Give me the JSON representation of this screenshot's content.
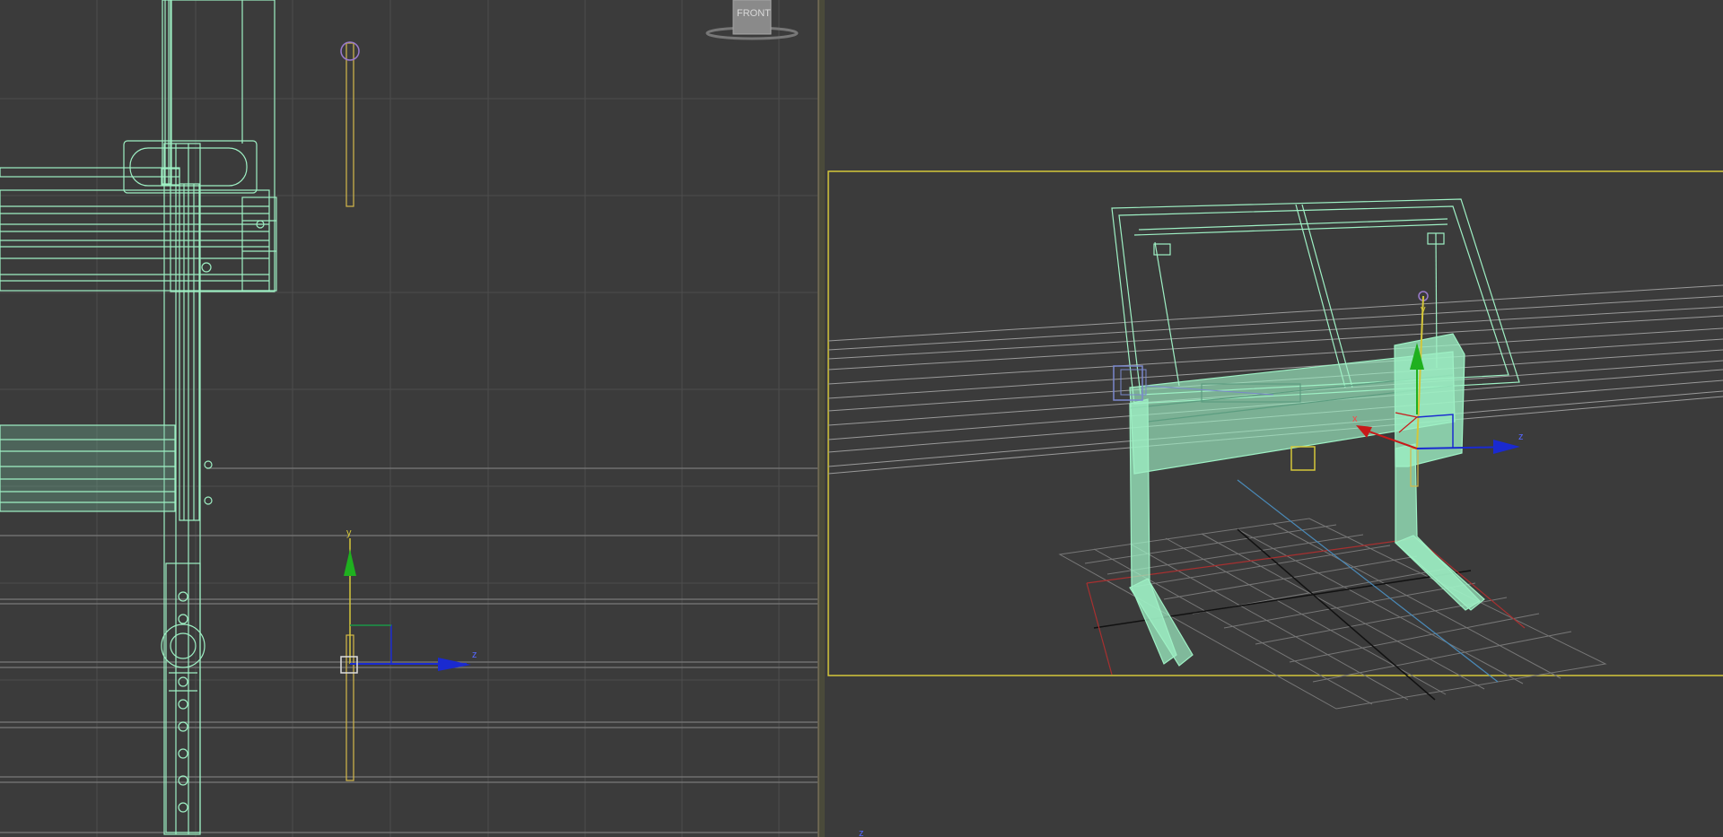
{
  "left_viewport": {
    "viewcube": {
      "face_label": "FRONT"
    },
    "gizmo": {
      "y_label": "y",
      "z_label": "z"
    }
  },
  "right_viewport": {
    "gizmo": {
      "x_label": "x",
      "y_label": "y",
      "z_label": "z"
    },
    "corner_axis_label": "z"
  },
  "colors": {
    "viewport_bg": "#3b3b3b",
    "grid": "#4c4c4c",
    "wireframe": "#9ef0c4",
    "selection_frame": "#d4c73a",
    "axis_x": "#c81a1a",
    "axis_y": "#1fb01f",
    "axis_z": "#1a2ad0"
  },
  "icons": [
    "viewcube-icon",
    "transform-gizmo-icon",
    "light-icon",
    "camera-icon"
  ]
}
